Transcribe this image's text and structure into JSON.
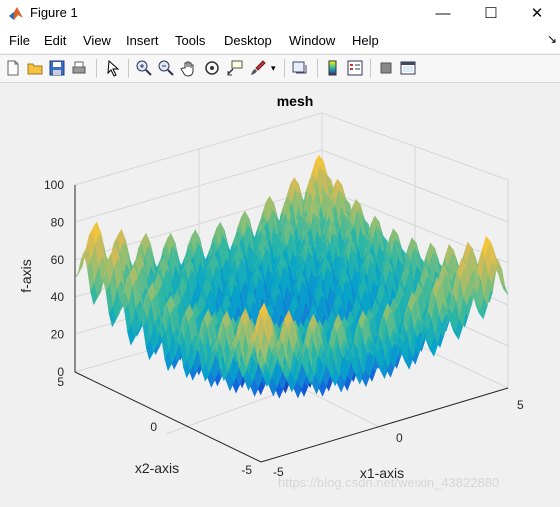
{
  "window": {
    "title": "Figure 1",
    "controls": [
      "—",
      "☐",
      "✕"
    ]
  },
  "menu": [
    {
      "label": "File"
    },
    {
      "label": "Edit"
    },
    {
      "label": "View"
    },
    {
      "label": "Insert"
    },
    {
      "label": "Tools"
    },
    {
      "label": "Desktop"
    },
    {
      "label": "Window"
    },
    {
      "label": "Help"
    }
  ],
  "menu_overflow_icon": "dock-arrow-icon",
  "toolbar": [
    "new-figure-icon",
    "open-file-icon",
    "save-icon",
    "print-icon",
    "pointer-icon",
    "zoom-in-icon",
    "zoom-out-icon",
    "pan-icon",
    "rotate-3d-icon",
    "data-cursor-icon",
    "brush-icon",
    "brush-dropdown-icon",
    "link-plot-icon",
    "colorbar-icon",
    "legend-icon",
    "hide-plot-tools-icon",
    "show-plot-tools-icon"
  ],
  "chart_data": {
    "type": "surface",
    "title": "mesh",
    "xlabel": "x1-axis",
    "ylabel": "x2-axis",
    "zlabel": "f-axis",
    "x_ticks": [
      "-5",
      "0",
      "5"
    ],
    "y_ticks": [
      "-5",
      "0",
      "5"
    ],
    "z_ticks": [
      "0",
      "20",
      "40",
      "60",
      "80",
      "100"
    ],
    "xlim": [
      -5,
      5
    ],
    "ylim": [
      -5,
      5
    ],
    "zlim": [
      0,
      100
    ],
    "grid": true,
    "colormap": "parula",
    "colors": [
      "#352a87",
      "#0f5cdd",
      "#1481d6",
      "#06a4ca",
      "#2eb7a4",
      "#87bf77",
      "#d1bb59",
      "#fec832",
      "#f9fb0e"
    ]
  },
  "watermark": "https://blog.csdn.net/weixin_43822880"
}
